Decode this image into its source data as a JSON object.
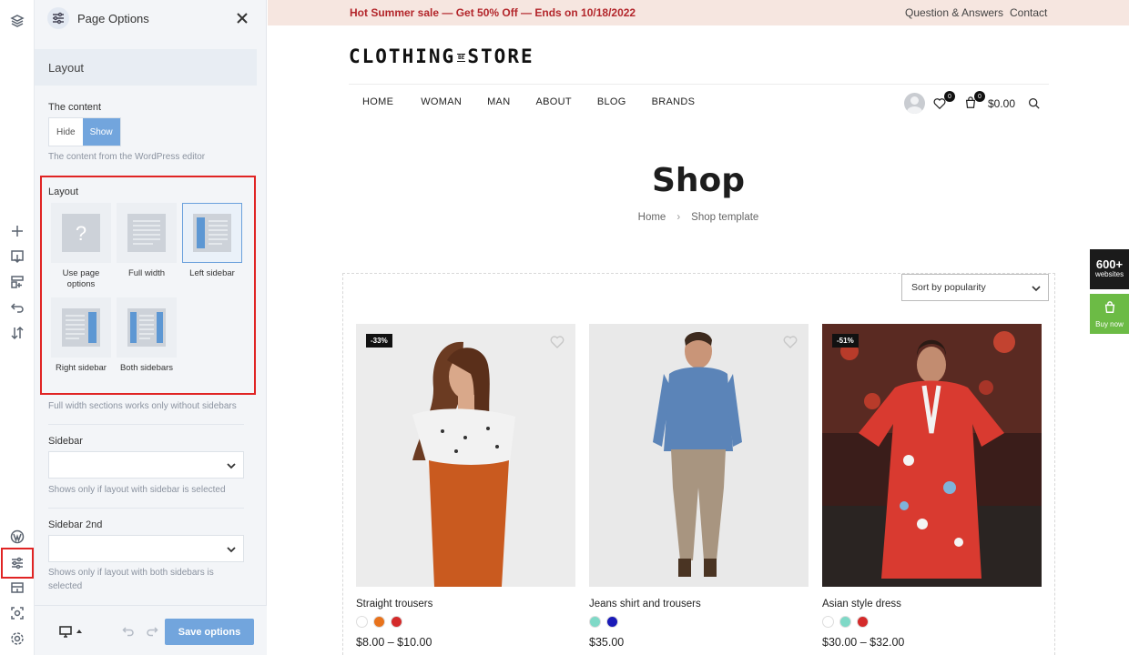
{
  "panel": {
    "title": "Page Options",
    "section_title": "Layout",
    "content_label": "The content",
    "content_options": [
      "Hide",
      "Show"
    ],
    "content_selected": "Show",
    "content_hint": "The content from the WordPress editor",
    "layout_label": "Layout",
    "layouts": [
      {
        "label": "Use page options"
      },
      {
        "label": "Full width"
      },
      {
        "label": "Left sidebar"
      },
      {
        "label": "Right sidebar"
      },
      {
        "label": "Both sidebars"
      }
    ],
    "layout_selected": "Left sidebar",
    "layout_hint": "Full width sections works only without sidebars",
    "sidebar_label": "Sidebar",
    "sidebar_value": "",
    "sidebar_hint": "Shows only if layout with sidebar is selected",
    "sidebar2_label": "Sidebar 2nd",
    "sidebar2_value": "",
    "sidebar2_hint": "Shows only if layout with both sidebars is selected",
    "save_label": "Save options"
  },
  "rail": {
    "top_icon": "layers-icon",
    "tools": [
      "plus-icon",
      "add-section-icon",
      "wrap-icon",
      "undo-icon",
      "sort-icon"
    ],
    "bottom": [
      "wordpress-icon",
      "page-options-icon",
      "export-icon",
      "preview-icon",
      "settings-icon"
    ]
  },
  "site": {
    "promo": "Hot Summer sale — Get 50% Off — Ends on 10/18/2022",
    "top_links": [
      "Question & Answers",
      "Contact"
    ],
    "logo_left": "CLOTHING",
    "logo_mid": "BE",
    "logo_right": "STORE",
    "nav": [
      "HOME",
      "WOMAN",
      "MAN",
      "ABOUT",
      "BLOG",
      "BRANDS"
    ],
    "wishlist_count": "0",
    "cart_count": "0",
    "cart_total": "$0.00",
    "page_title": "Shop",
    "breadcrumb_home": "Home",
    "breadcrumb_current": "Shop template",
    "sort_label": "Sort by popularity",
    "products": [
      {
        "name": "Straight trousers",
        "discount": "-33%",
        "price": "$8.00 – $10.00",
        "swatches": [
          "#ffffff",
          "#e8731c",
          "#d42a2a"
        ]
      },
      {
        "name": "Jeans shirt and trousers",
        "discount": "",
        "price": "$35.00",
        "swatches": [
          "#7fd9c7",
          "#1a1ab8"
        ]
      },
      {
        "name": "Asian style dress",
        "discount": "-51%",
        "price": "$30.00 – $32.00",
        "swatches": [
          "#ffffff",
          "#7fd9c7",
          "#d42a2a"
        ]
      }
    ],
    "float_count": "600+",
    "float_count_label": "websites",
    "float_buy": "Buy now"
  },
  "colors": {
    "accent": "#72a5dd",
    "promo_bg": "#f6e6e0",
    "promo_text": "#b3262b",
    "highlight": "#e02424",
    "buy_green": "#6cbb45"
  }
}
